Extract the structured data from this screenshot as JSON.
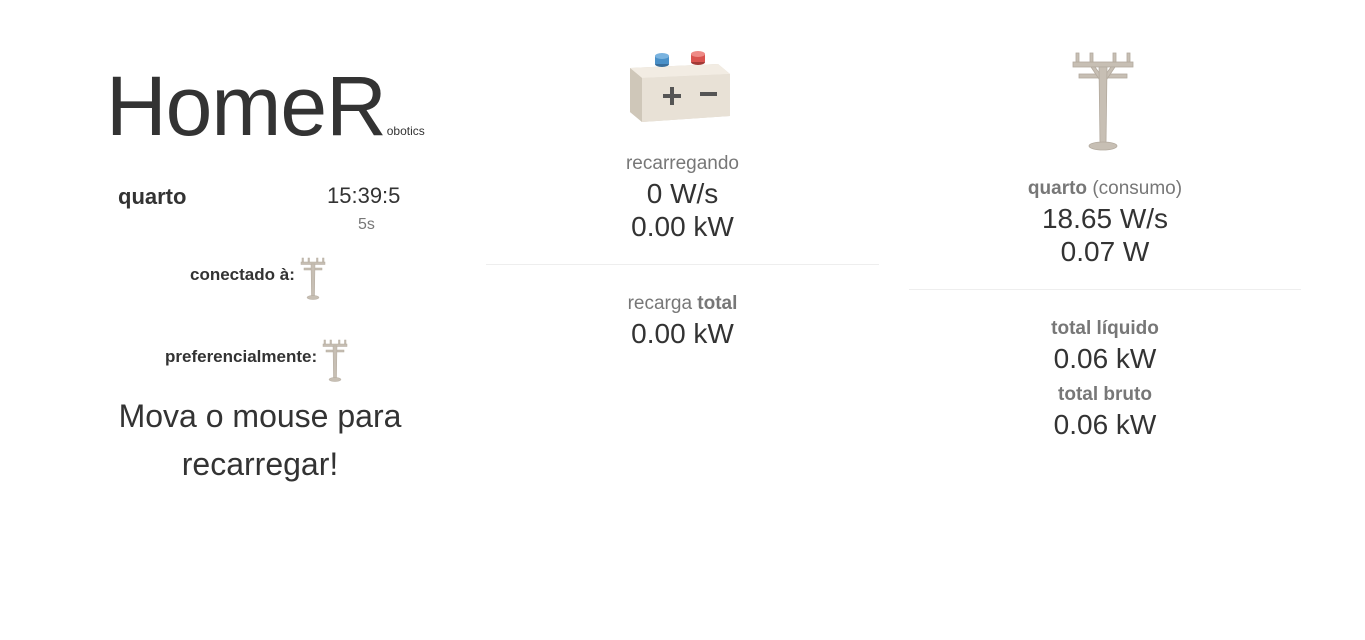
{
  "brand": {
    "main": "HomeR",
    "sub": "obotics"
  },
  "room": {
    "name": "quarto",
    "clock": "15:39:5",
    "clock_sub": "5s"
  },
  "connection": {
    "connected_label": "conectado à:",
    "connected_icon": "power-pole-icon",
    "preferred_label": "preferencialmente:",
    "preferred_icon": "power-pole-icon"
  },
  "message": "Mova o mouse para recarregar!",
  "battery": {
    "icon": "battery-icon",
    "status": "recarregando",
    "rate": "0 W/s",
    "power": "0.00 kW",
    "total_label_prefix": "recarga",
    "total_label_bold": "total",
    "total_value": "0.00 kW"
  },
  "consumption": {
    "icon": "power-pole-icon",
    "room": "quarto",
    "suffix": "(consumo)",
    "rate": "18.65 W/s",
    "power": "0.07 W",
    "net_label": "total líquido",
    "net_value": "0.06 kW",
    "gross_label": "total bruto",
    "gross_value": "0.06 kW"
  },
  "colors": {
    "text": "#333333",
    "muted": "#777777",
    "divider": "#eeeeee",
    "battery_body": "#e8e1d6",
    "battery_blue": "#4a90c8",
    "battery_red": "#d9534f",
    "pole": "#c7bfb4"
  }
}
